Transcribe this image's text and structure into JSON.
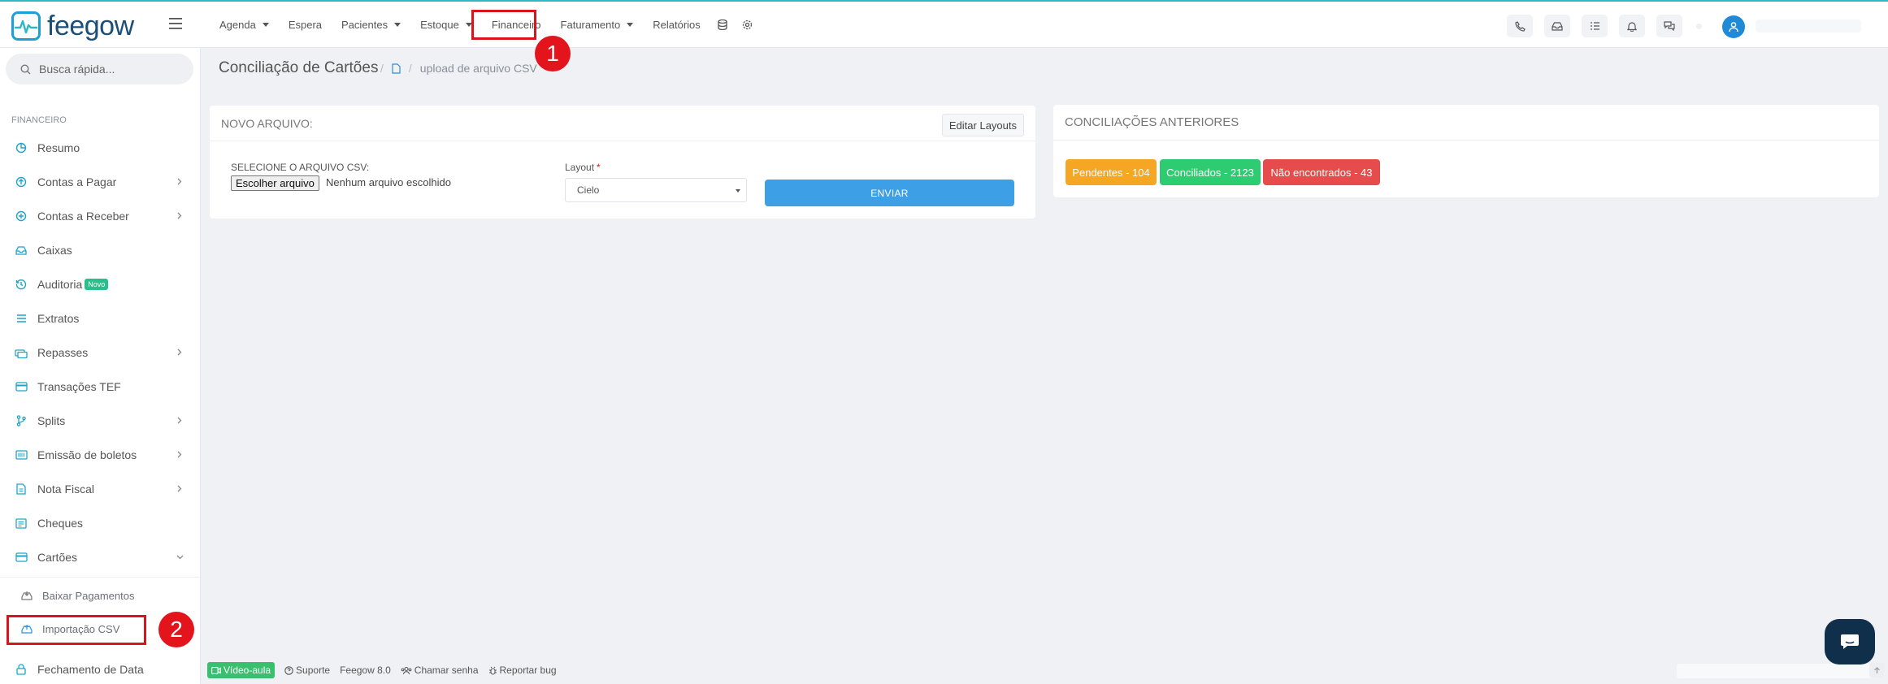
{
  "app": {
    "logo_text": "feegow"
  },
  "topnav": {
    "items": [
      {
        "label": "Agenda",
        "has_caret": true
      },
      {
        "label": "Espera",
        "has_caret": false
      },
      {
        "label": "Pacientes",
        "has_caret": true
      },
      {
        "label": "Estoque",
        "has_caret": true
      },
      {
        "label": "Financeiro",
        "has_caret": false
      },
      {
        "label": "Faturamento",
        "has_caret": true
      },
      {
        "label": "Relatórios",
        "has_caret": false
      }
    ],
    "extra_icons": [
      "database-icon",
      "gear-icon"
    ]
  },
  "annotations": {
    "step1": "1",
    "step2": "2",
    "highlight_color": "#d9141d",
    "badge_color": "#e3141c"
  },
  "top_right_icons": [
    "phone-icon",
    "inbox-icon",
    "checklist-icon",
    "bell-icon",
    "chat-icon"
  ],
  "search": {
    "placeholder": "Busca rápida..."
  },
  "sidebar": {
    "section_title": "FINANCEIRO",
    "items": [
      {
        "label": "Resumo",
        "icon": "pie-chart-icon"
      },
      {
        "label": "Contas a Pagar",
        "icon": "arrow-up-circle-icon",
        "chevron": "right"
      },
      {
        "label": "Contas a Receber",
        "icon": "plus-circle-icon",
        "chevron": "right"
      },
      {
        "label": "Caixas",
        "icon": "inbox-icon"
      },
      {
        "label": "Auditoria",
        "icon": "history-icon",
        "badge": "Novo"
      },
      {
        "label": "Extratos",
        "icon": "list-icon"
      },
      {
        "label": "Repasses",
        "icon": "money-stack-icon",
        "chevron": "right"
      },
      {
        "label": "Transações TEF",
        "icon": "credit-card-icon"
      },
      {
        "label": "Splits",
        "icon": "branch-icon",
        "chevron": "right"
      },
      {
        "label": "Emissão de boletos",
        "icon": "barcode-icon",
        "chevron": "right"
      },
      {
        "label": "Nota Fiscal",
        "icon": "document-icon",
        "chevron": "right"
      },
      {
        "label": "Cheques",
        "icon": "cheque-icon"
      },
      {
        "label": "Cartões",
        "icon": "credit-card-icon",
        "chevron": "down"
      }
    ],
    "sub_items": [
      {
        "label": "Baixar Pagamentos",
        "icon": "download-tray-icon"
      },
      {
        "label": "Importação CSV",
        "icon": "upload-tray-icon"
      }
    ],
    "bottom_item": {
      "label": "Fechamento de Data",
      "icon": "lock-icon"
    }
  },
  "page": {
    "title": "Conciliação de Cartões",
    "breadcrumb": "upload de arquivo CSV"
  },
  "new_file_panel": {
    "title": "NOVO ARQUIVO:",
    "edit_layouts": "Editar Layouts",
    "file_label": "SELECIONE O ARQUIVO CSV:",
    "file_button": "Escolher arquivo",
    "file_status": "Nenhum arquivo escolhido",
    "layout_label": "Layout",
    "layout_required": "*",
    "layout_value": "Cielo",
    "send_button": "ENVIAR"
  },
  "previous_panel": {
    "title": "CONCILIAÇÕES ANTERIORES",
    "pills": [
      {
        "label": "Pendentes - 104",
        "color": "#f5a623"
      },
      {
        "label": "Conciliados - 2123",
        "color": "#2ecc71"
      },
      {
        "label": "Não encontrados - 43",
        "color": "#e74c4c"
      }
    ]
  },
  "footer": {
    "video": "Vídeo-aula",
    "support": "Suporte",
    "version": "Feegow 8.0",
    "call": "Chamar senha",
    "bug": "Reportar bug"
  }
}
